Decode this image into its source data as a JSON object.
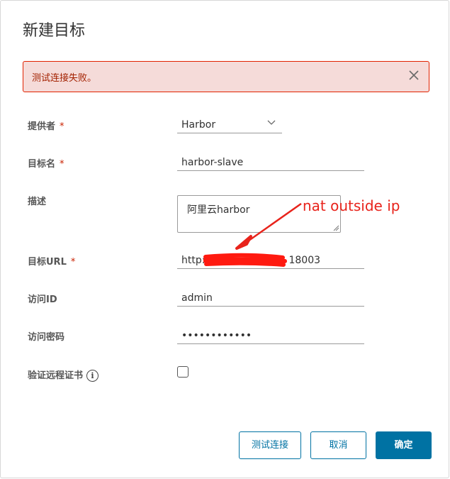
{
  "dialog": {
    "title": "新建目标",
    "alert": {
      "message": "测试连接失败。",
      "close_icon": "close-icon"
    },
    "fields": {
      "provider": {
        "label": "提供者",
        "required_mark": "*",
        "value": "Harbor"
      },
      "target_name": {
        "label": "目标名",
        "required_mark": "*",
        "value": "harbor-slave"
      },
      "description": {
        "label": "描述",
        "value": "阿里云harbor"
      },
      "target_url": {
        "label": "目标URL",
        "required_mark": "*",
        "value_prefix": "http:",
        "value_suffix": "18003"
      },
      "access_id": {
        "label": "访问ID",
        "value": "admin"
      },
      "access_secret": {
        "label": "访问密码",
        "value": "••••••••••••"
      },
      "verify_cert": {
        "label": "验证远程证书",
        "info_icon": "i",
        "checked": false
      }
    },
    "buttons": {
      "test": "测试连接",
      "cancel": "取消",
      "ok": "确定"
    },
    "annotation": "nat outside ip",
    "colors": {
      "primary": "#0072a3",
      "danger": "#e12200",
      "annotation": "#e8231b"
    }
  }
}
